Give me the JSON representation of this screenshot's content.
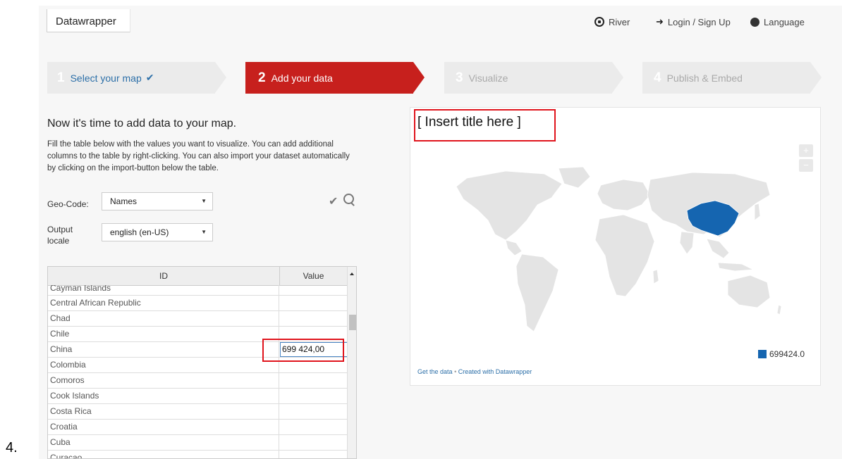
{
  "list_marker": "4.",
  "header": {
    "brand": "Datawrapper",
    "nav": [
      {
        "label": "River",
        "icon": "river-icon"
      },
      {
        "label": "Login / Sign Up",
        "icon": "sign-in-icon"
      },
      {
        "label": "Language",
        "icon": "globe-icon"
      }
    ]
  },
  "steps": [
    {
      "num": "1",
      "label": "Select your map",
      "state": "done"
    },
    {
      "num": "2",
      "label": "Add your data",
      "state": "active"
    },
    {
      "num": "3",
      "label": "Visualize",
      "state": "inactive"
    },
    {
      "num": "4",
      "label": "Publish & Embed",
      "state": "inactive"
    }
  ],
  "left": {
    "heading": "Now it's time to add data to your map.",
    "intro": "Fill the table below with the values you want to visualize. You can add additional columns to the table by right-clicking. You can also import your dataset automatically by clicking on the import-button below the table.",
    "geo_code_label": "Geo-Code:",
    "geo_code_value": "Names",
    "locale_label": "Output locale",
    "locale_value": "english (en-US)"
  },
  "table": {
    "columns": [
      "ID",
      "Value"
    ],
    "rows": [
      {
        "id": "Cayman Islands",
        "value": ""
      },
      {
        "id": "Central African Republic",
        "value": ""
      },
      {
        "id": "Chad",
        "value": ""
      },
      {
        "id": "Chile",
        "value": ""
      },
      {
        "id": "China",
        "value": "699 424,00"
      },
      {
        "id": "Colombia",
        "value": ""
      },
      {
        "id": "Comoros",
        "value": ""
      },
      {
        "id": "Cook Islands",
        "value": ""
      },
      {
        "id": "Costa Rica",
        "value": ""
      },
      {
        "id": "Croatia",
        "value": ""
      },
      {
        "id": "Cuba",
        "value": ""
      },
      {
        "id": "Curacao",
        "value": ""
      }
    ]
  },
  "map": {
    "title": "[ Insert title here ]",
    "zoom_in": "+",
    "zoom_out": "−",
    "legend_value": "699424.0",
    "highlight_color": "#1565b0",
    "land_color": "#e4e4e4",
    "credit_get": "Get the data",
    "credit_sep": "•",
    "credit_made": "Created with Datawrapper"
  },
  "colors": {
    "accent_red": "#c7201d",
    "link_blue": "#2c6fa8",
    "annotation_red": "#e0141c"
  }
}
